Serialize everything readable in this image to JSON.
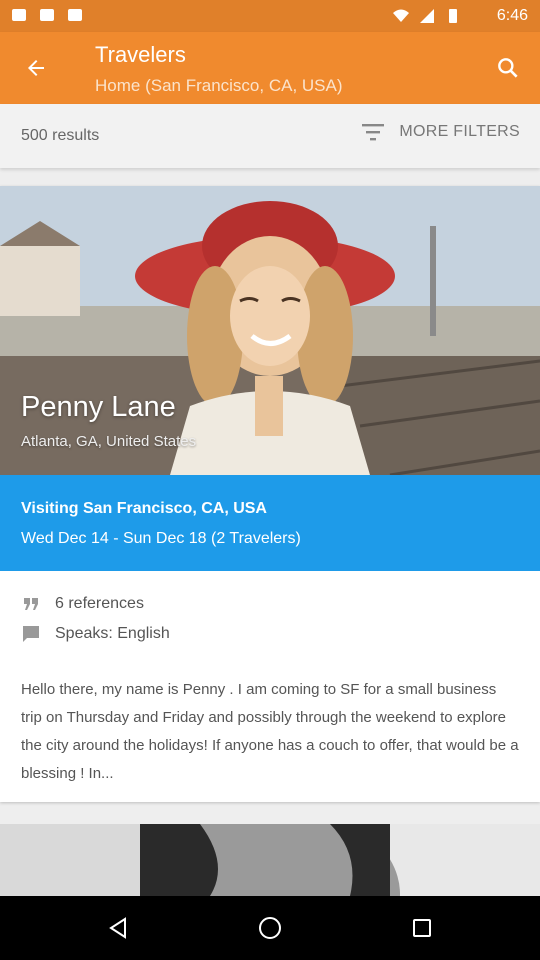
{
  "status_bar": {
    "time": "6:46"
  },
  "app_bar": {
    "title": "Travelers",
    "subtitle": "Home (San Francisco, CA, USA)"
  },
  "filters": {
    "results_count": "500 results",
    "more_filters_label": "MORE FILTERS"
  },
  "traveler": {
    "name": "Penny  Lane",
    "location": "Atlanta, GA, United States",
    "visiting": "Visiting San Francisco, CA, USA",
    "dates": "Wed Dec 14 - Sun Dec 18 (2 Travelers)",
    "references": "6 references",
    "speaks": "Speaks: English",
    "description": "Hello there, my name is Penny . I am coming to SF for a small business trip on Thursday and Friday and possibly through the weekend to explore the city around the holidays! If anyone has a couch to offer, that would be a blessing ! In..."
  },
  "colors": {
    "app_bar": "#f08a2e",
    "status_bar": "#e0802a",
    "visit_banner": "#1e9be9"
  },
  "icons": [
    "arrow-back-icon",
    "search-icon",
    "filter-icon",
    "quote-icon",
    "chat-icon",
    "back-triangle-icon",
    "home-circle-icon",
    "recents-square-icon"
  ]
}
